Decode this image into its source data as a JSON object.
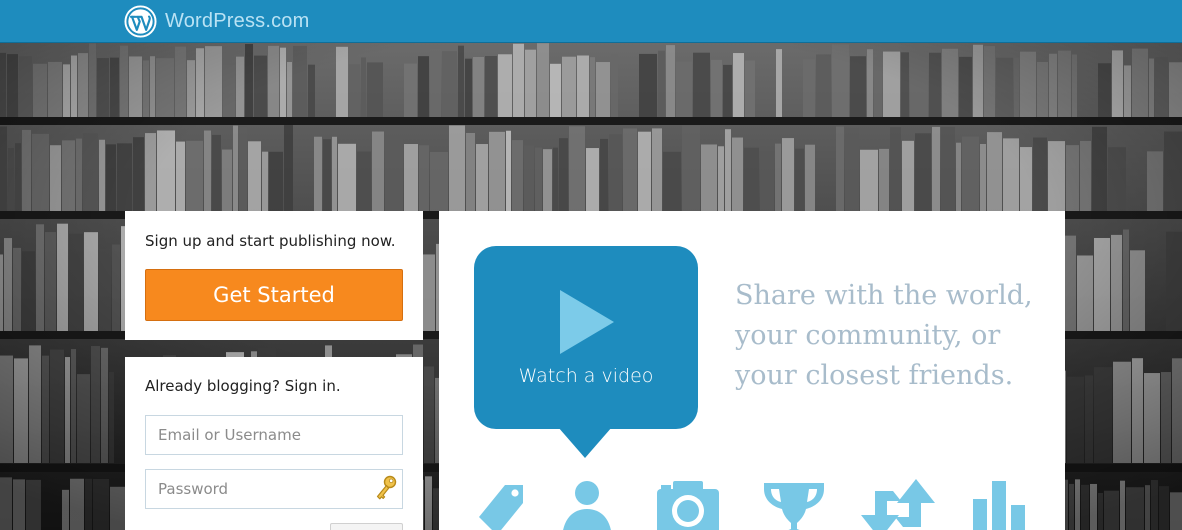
{
  "header": {
    "brand": "WordPress.com",
    "logo_icon": "wordpress-logo-icon",
    "bar_color": "#1e8cbe"
  },
  "signup": {
    "prompt": "Sign up and start publishing now.",
    "button_label": "Get Started",
    "button_color": "#f7891e"
  },
  "signin": {
    "prompt": "Already blogging? Sign in.",
    "username_placeholder": "Email or Username",
    "password_placeholder": "Password",
    "key_icon": "key-icon"
  },
  "hero": {
    "video_label": "Watch a video",
    "play_icon": "play-icon",
    "tagline_lines": [
      "Share with the world,",
      "your community, or",
      "your closest friends."
    ],
    "feature_icons": [
      "tag-icon",
      "person-icon",
      "camera-icon",
      "trophy-icon",
      "share-arrows-icon",
      "stats-icon"
    ],
    "icon_color": "#78c8e6"
  }
}
